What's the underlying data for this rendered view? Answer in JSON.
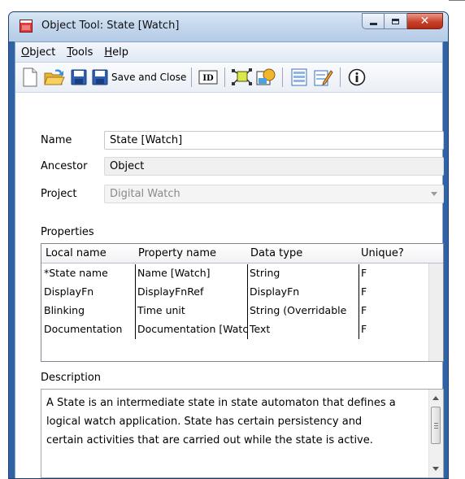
{
  "window": {
    "title": "Object Tool: State [Watch]"
  },
  "menu": [
    {
      "label": "Object",
      "key": "O",
      "rest": "bject"
    },
    {
      "label": "Tools",
      "key": "T",
      "rest": "ools"
    },
    {
      "label": "Help",
      "key": "H",
      "rest": "elp"
    }
  ],
  "toolbar": {
    "save_and_close": "Save and Close",
    "id_label": "ID",
    "icons": [
      "new-document-icon",
      "open-folder-icon",
      "save-icon",
      "save-and-close-icon",
      "id-icon",
      "object-graph-icon",
      "object-symbol-icon",
      "property-dialog-icon",
      "edit-form-icon",
      "info-icon"
    ]
  },
  "form": {
    "name_label": "Name",
    "name_value": "State [Watch]",
    "ancestor_label": "Ancestor",
    "ancestor_value": "Object",
    "project_label": "Project",
    "project_value": "Digital Watch"
  },
  "properties": {
    "label": "Properties",
    "columns": [
      "Local name",
      "Property name",
      "Data type",
      "Unique?"
    ],
    "rows": [
      [
        "*State name",
        "Name [Watch]",
        "String",
        "F"
      ],
      [
        "DisplayFn",
        "DisplayFnRef",
        "DisplayFn",
        "F"
      ],
      [
        "Blinking",
        "Time unit",
        "String (Overridable",
        "F"
      ],
      [
        "Documentation",
        "Documentation [Watch]",
        "Text",
        "F"
      ]
    ]
  },
  "description": {
    "label": "Description",
    "lines": [
      "A State is an intermediate state in state automaton that defines a",
      "logical watch application. State has certain persistency and",
      "certain activities that are carried out while the state is active."
    ]
  },
  "colors": {
    "window_frame": "#2f63a6",
    "title_gradient_top": "#d9e6f4",
    "close_button": "#c8402a"
  }
}
